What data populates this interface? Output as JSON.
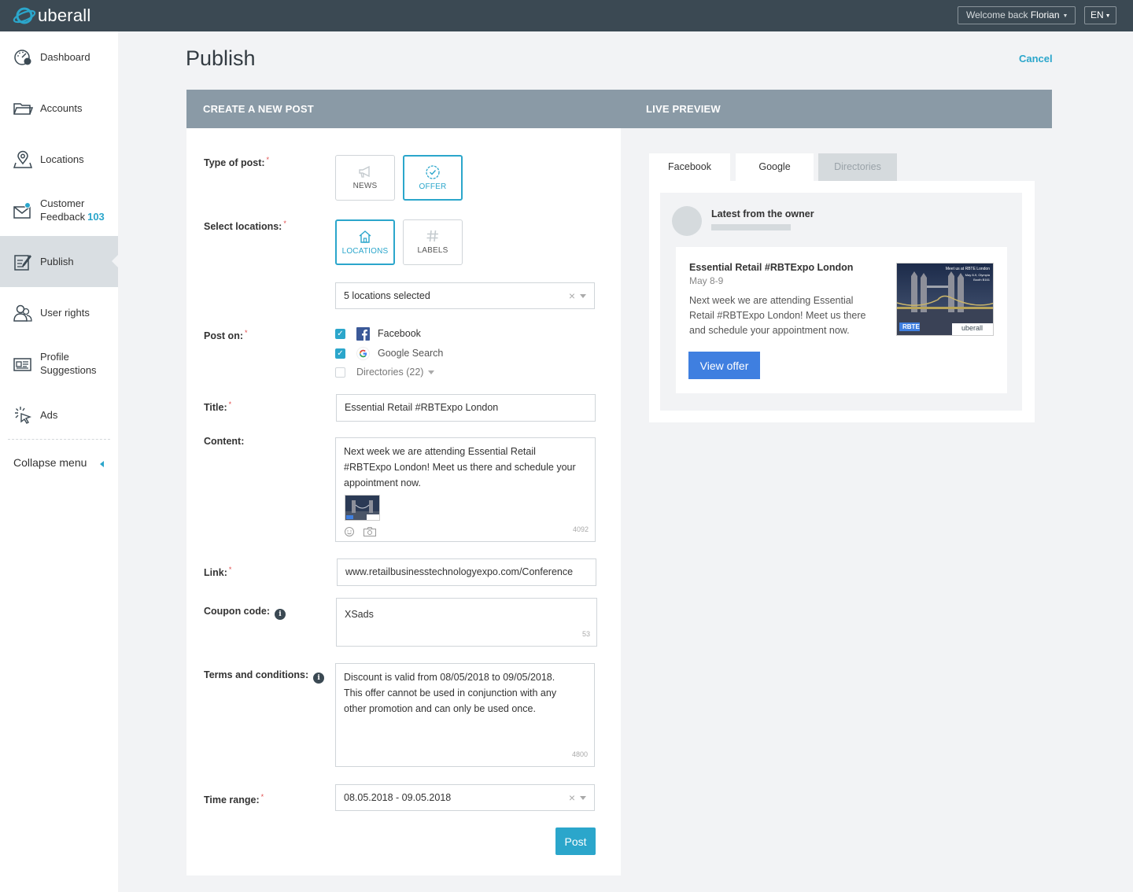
{
  "brand": {
    "name": "uberall",
    "accent": "#2ba6cb",
    "topbar_color": "#3b4953"
  },
  "header": {
    "welcome_prefix": "Welcome back",
    "user": "Florian",
    "lang": "EN"
  },
  "sidebar": {
    "items": [
      {
        "label": "Dashboard",
        "icon": "dashboard-icon"
      },
      {
        "label": "Accounts",
        "icon": "folder-icon"
      },
      {
        "label": "Locations",
        "icon": "location-pin-icon"
      },
      {
        "label": "Customer",
        "label2": "Feedback",
        "badge": "103",
        "icon": "mail-icon"
      },
      {
        "label": "Publish",
        "icon": "edit-icon",
        "active": true
      },
      {
        "label": "User rights",
        "icon": "users-icon"
      },
      {
        "label": "Profile",
        "label2": "Suggestions",
        "icon": "id-card-icon"
      },
      {
        "label": "Ads",
        "icon": "cursor-click-icon"
      }
    ],
    "collapse_label": "Collapse menu"
  },
  "page": {
    "title": "Publish",
    "cancel": "Cancel"
  },
  "form": {
    "header": "CREATE A NEW POST",
    "type_label": "Type of post:",
    "type_options": [
      {
        "label": "NEWS",
        "icon": "megaphone-icon"
      },
      {
        "label": "OFFER",
        "icon": "offer-badge-icon",
        "selected": true
      }
    ],
    "locations_label": "Select locations:",
    "location_options": [
      {
        "label": "LOCATIONS",
        "icon": "home-icon",
        "selected": true
      },
      {
        "label": "LABELS",
        "icon": "hashtag-icon"
      }
    ],
    "locations_value": "5 locations selected",
    "post_on_label": "Post on:",
    "post_on": [
      {
        "label": "Facebook",
        "checked": true,
        "icon": "facebook-icon"
      },
      {
        "label": "Google Search",
        "checked": true,
        "icon": "google-icon"
      },
      {
        "label": "Directories (22)",
        "checked": false
      }
    ],
    "title_label": "Title:",
    "title_value": "Essential Retail #RBTExpo London",
    "content_label": "Content:",
    "content_lines": [
      "Next week we are attending Essential Retail",
      "#RBTExpo London! Meet us there and schedule your",
      "appointment now."
    ],
    "content_counter": "4092",
    "link_label": "Link:",
    "link_value": "www.retailbusinesstechnologyexpo.com/Conference",
    "coupon_label": "Coupon code:",
    "coupon_value": "XSads",
    "coupon_counter": "53",
    "terms_label": "Terms and conditions:",
    "terms_lines": [
      "Discount is valid from 08/05/2018 to 09/05/2018.",
      "This offer cannot be used in conjunction with any",
      "other promotion and can only be used once."
    ],
    "terms_counter": "4800",
    "time_label": "Time range:",
    "time_value": "08.05.2018 - 09.05.2018",
    "post_button": "Post"
  },
  "preview": {
    "header": "LIVE PREVIEW",
    "tabs": [
      {
        "label": "Facebook"
      },
      {
        "label": "Google",
        "active": true
      },
      {
        "label": "Directories",
        "disabled": true
      }
    ],
    "owner_label": "Latest from the owner",
    "title": "Essential Retail #RBTExpo London",
    "date": "May 8-9",
    "text_lines": [
      "Next week we are attending Essential",
      "Retail #RBTExpo London! Meet us there",
      "and schedule your appointment now."
    ],
    "image_caption": "Meet us at RBTE London",
    "image_sub": "May 8-9, Olympia",
    "image_stand": "Booth B161",
    "image_badge": "RBTE",
    "image_logo": "uberall",
    "button": "View offer"
  }
}
